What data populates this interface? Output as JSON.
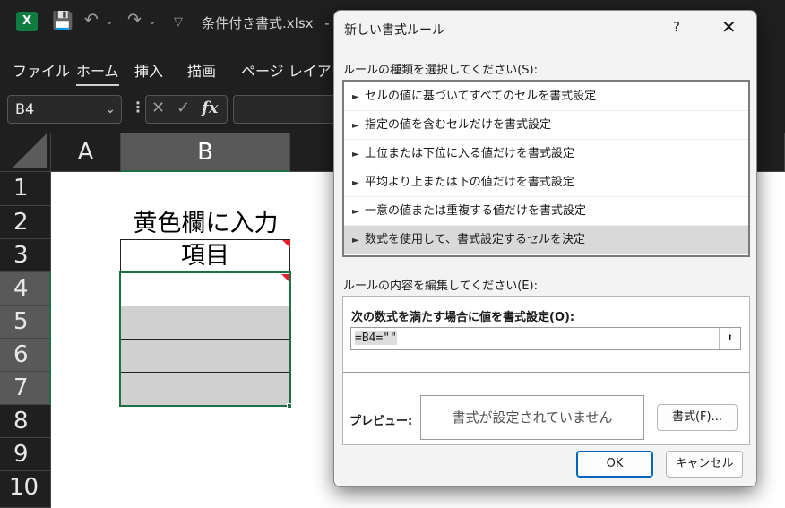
{
  "titlebar": {
    "app_icon_label": "X",
    "filename": "条件付き書式.xlsx",
    "separator": "-"
  },
  "menu": {
    "items": [
      "ファイル",
      "ホーム",
      "挿入",
      "描画",
      "ページ レイアウト"
    ],
    "active": "ホーム"
  },
  "formula_bar": {
    "name_box": "B4",
    "fx_label": "fx"
  },
  "sheet": {
    "columns": [
      "A",
      "B"
    ],
    "selected_column": "B",
    "rows": [
      "1",
      "2",
      "3",
      "4",
      "5",
      "6",
      "7",
      "8",
      "9",
      "10"
    ],
    "selected_rows": [
      "4",
      "5",
      "6",
      "7"
    ],
    "cells": {
      "B2": "黄色欄に入力",
      "B3": "項目"
    }
  },
  "dialog": {
    "title": "新しい書式ルール",
    "help": "?",
    "close": "✕",
    "rule_type_label": "ルールの種類を選択してください(S):",
    "rule_types": [
      "セルの値に基づいてすべてのセルを書式設定",
      "指定の値を含むセルだけを書式設定",
      "上位または下位に入る値だけを書式設定",
      "平均より上または下の値だけを書式設定",
      "一意の値または重複する値だけを書式設定",
      "数式を使用して、書式設定するセルを決定"
    ],
    "selected_rule_index": 5,
    "edit_label": "ルールの内容を編集してください(E):",
    "formula_label": "次の数式を満たす場合に値を書式設定(O):",
    "formula_value": "=B4=\"\"",
    "preview_label": "プレビュー:",
    "preview_text": "書式が設定されていません",
    "format_button": "書式(F)...",
    "ok_button": "OK",
    "cancel_button": "キャンセル"
  },
  "colors": {
    "accent_green": "#1e7145",
    "excel_green": "#107c41",
    "note_red": "#e0202a",
    "fill_gray": "#d0d0d0",
    "ok_blue": "#0067c0"
  }
}
